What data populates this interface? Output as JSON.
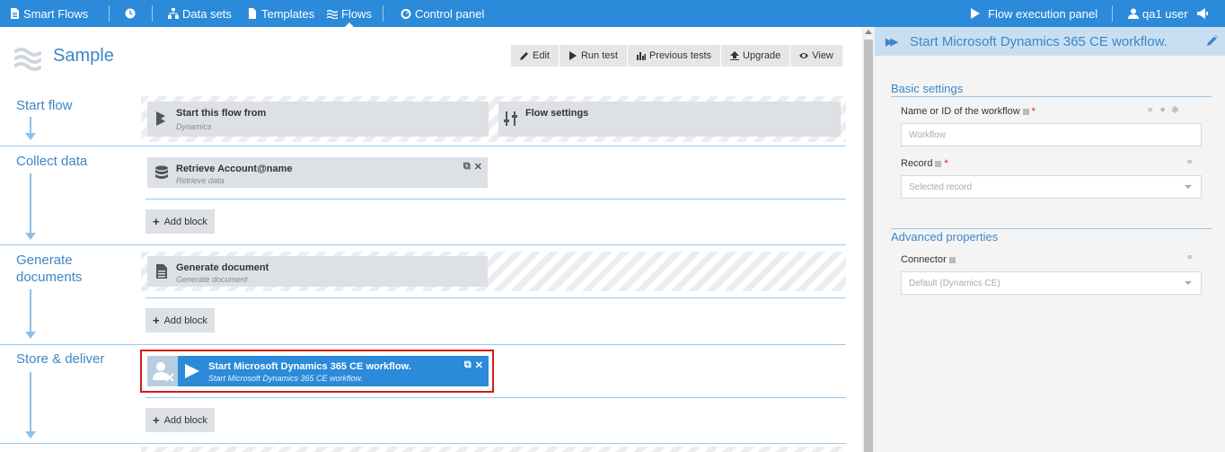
{
  "topbar": {
    "brand": "Smart Flows",
    "nav": [
      {
        "label": "Data sets",
        "icon": "sitemap-icon"
      },
      {
        "label": "Templates",
        "icon": "file-icon"
      },
      {
        "label": "Flows",
        "icon": "waves-icon",
        "active": true
      },
      {
        "label": "Control panel",
        "icon": "gauge-icon"
      }
    ],
    "flow_execution_panel": "Flow execution panel",
    "user": "qa1 user"
  },
  "page": {
    "title": "Sample",
    "toolbar": [
      "Edit",
      "Run test",
      "Previous tests",
      "Upgrade",
      "View"
    ]
  },
  "sections": {
    "start_flow": "Start flow",
    "collect_data": "Collect data",
    "generate_documents_line1": "Generate",
    "generate_documents_line2": "documents",
    "store_deliver": "Store & deliver"
  },
  "blocks": {
    "start_from": {
      "title": "Start this flow from",
      "subtitle": "Dynamics"
    },
    "flow_settings": {
      "title": "Flow settings"
    },
    "retrieve": {
      "title": "Retrieve Account@name",
      "subtitle": "Retrieve data"
    },
    "generate": {
      "title": "Generate document",
      "subtitle": "Generate document"
    },
    "start_workflow": {
      "title": "Start Microsoft Dynamics 365 CE workflow.",
      "subtitle": "Start Microsoft Dynamics 365 CE workflow."
    }
  },
  "add_block_label": "Add block",
  "panel": {
    "title": "Start Microsoft Dynamics 365 CE workflow.",
    "basic_settings": "Basic settings",
    "workflow_label": "Name or ID of the workflow",
    "workflow_placeholder": "Workflow",
    "record_label": "Record",
    "record_placeholder": "Selected record",
    "advanced_properties": "Advanced properties",
    "connector_label": "Connector",
    "connector_value": "Default (Dynamics CE)",
    "required_mark": "*"
  },
  "colors": {
    "topbar": "#2b8ad9",
    "accent_text": "#3e86c8",
    "block_bg": "#dde1e6",
    "selection_outline": "#d21b1b"
  }
}
